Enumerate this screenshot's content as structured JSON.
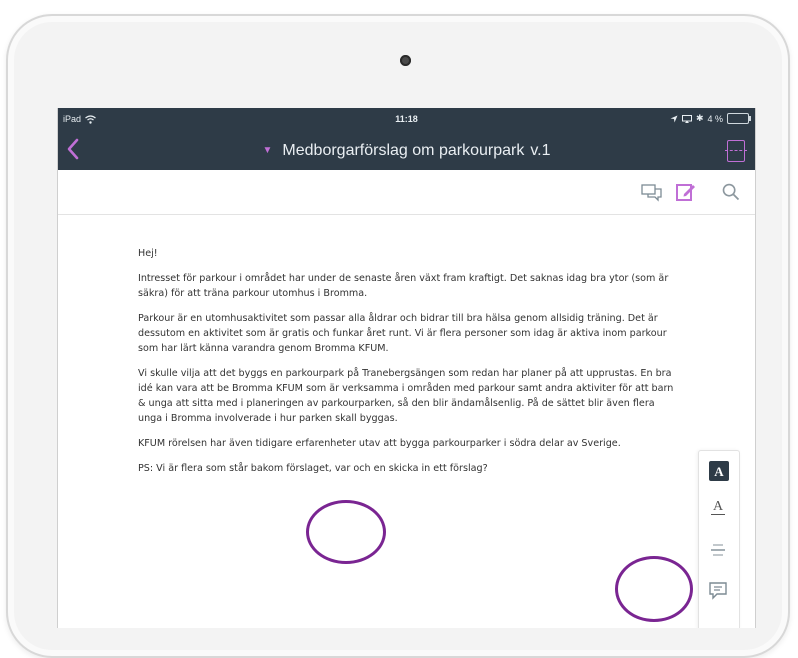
{
  "status_bar": {
    "carrier": "iPad",
    "time": "11:18",
    "battery": "4 %"
  },
  "nav": {
    "title": "Medborgarförslag om parkourpark",
    "version": "v.1"
  },
  "icons": {
    "back": "chevron-left-icon",
    "doc_menu": "caret-down-icon",
    "layout": "layout-icon",
    "comments": "comments-icon",
    "edit": "edit-icon",
    "search": "search-icon"
  },
  "document": {
    "paragraphs": [
      "Hej!",
      "Intresset för parkour i området har under de senaste åren växt fram kraftigt. Det saknas idag bra ytor (som är säkra) för att träna parkour utomhus i Bromma.",
      " Parkour är en utomhusaktivitet som passar alla åldrar och bidrar till bra hälsa genom allsidig träning. Det är dessutom en aktivitet som är gratis och funkar året runt. Vi är flera personer som idag är aktiva inom parkour som har lärt känna varandra genom Bromma KFUM.",
      "Vi skulle vilja att det byggs en parkourpark på Tranebergsängen som redan har planer på att upprustas. En bra idé kan vara att be Bromma KFUM som är verksamma i områden med parkour samt andra aktiviter för att barn & unga att sitta med i planeringen av parkourparken, så den blir ändamålsenlig. På de sättet blir även flera unga i Bromma involverade i hur parken skall byggas.",
      "KFUM rörelsen har även tidigare erfarenheter utav att bygga parkourparker i södra delar av Sverige.",
      "PS: Vi är flera som står bakom förslaget, var och en skicka in ett förslag?"
    ]
  },
  "format_panel": {
    "highlight_label": "A",
    "underline_label": "A"
  },
  "colors": {
    "bar_bg": "#2e3b47",
    "accent": "#c06fd6",
    "annotation": "#7a2592"
  }
}
